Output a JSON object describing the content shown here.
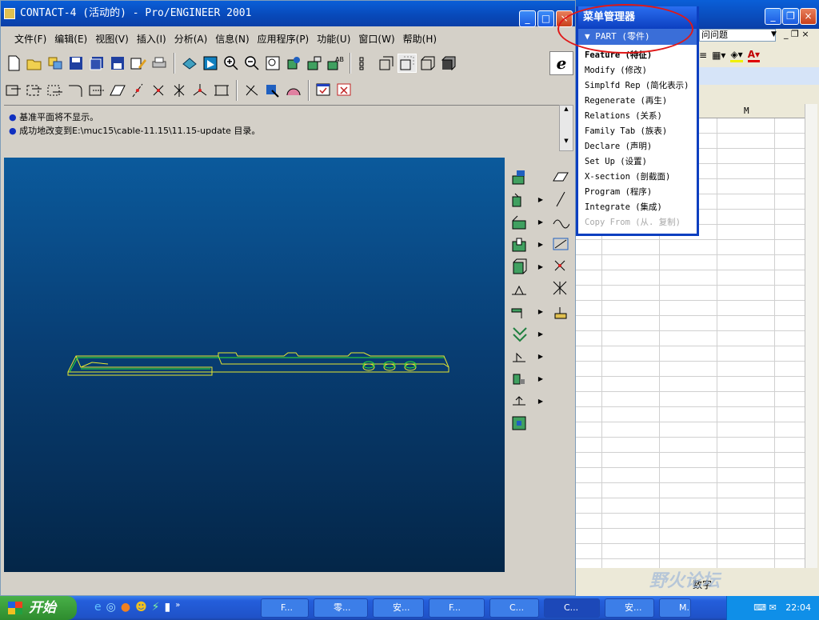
{
  "proe": {
    "title": "CONTACT-4 (活动的) - Pro/ENGINEER 2001",
    "menubar": [
      "文件(F)",
      "编辑(E)",
      "视图(V)",
      "插入(I)",
      "分析(A)",
      "信息(N)",
      "应用程序(P)",
      "功能(U)",
      "窗口(W)",
      "帮助(H)"
    ],
    "messages": [
      "基准平面将不显示。",
      "成功地改变到E:\\muc15\\cable-11.15\\11.15-update 目录。"
    ],
    "colors": {
      "viewport_top": "#0b5a9c",
      "viewport_bottom": "#042648",
      "model": "#e8e830"
    }
  },
  "menu_manager": {
    "title": "菜单管理器",
    "submenu": "PART (零件)",
    "items": [
      {
        "label": "Feature (特征)",
        "state": "bold"
      },
      {
        "label": "Modify (修改)",
        "state": "normal"
      },
      {
        "label": "Simplfd Rep (简化表示)",
        "state": "normal"
      },
      {
        "label": "Regenerate (再生)",
        "state": "normal"
      },
      {
        "label": "Relations (关系)",
        "state": "normal"
      },
      {
        "label": "Family Tab (族表)",
        "state": "normal"
      },
      {
        "label": "Declare (声明)",
        "state": "normal"
      },
      {
        "label": "Set Up (设置)",
        "state": "normal"
      },
      {
        "label": "X-section (剖截面)",
        "state": "normal"
      },
      {
        "label": "Program (程序)",
        "state": "normal"
      },
      {
        "label": "Integrate (集成)",
        "state": "normal"
      },
      {
        "label": "Copy From (从. 复制)",
        "state": "disabled"
      }
    ]
  },
  "excel": {
    "question_box": "问问题",
    "column_m": "M",
    "status_text": "数字"
  },
  "watermark": "野火论坛",
  "taskbar": {
    "start_label": "开始",
    "tasks": [
      "F...",
      "零...",
      "安...",
      "F...",
      "C...",
      "C...",
      "安...",
      "M..."
    ],
    "clock": "22:04"
  }
}
